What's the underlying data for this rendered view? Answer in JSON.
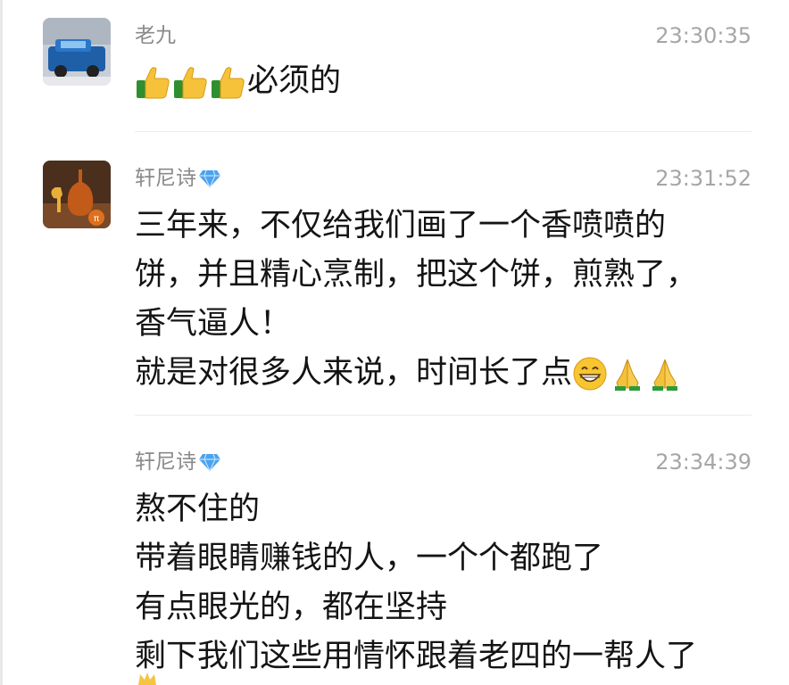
{
  "comments": [
    {
      "user": "老九",
      "time": "23:30:35",
      "lines": [
        "必须的"
      ],
      "emojis": [
        "thumbs-up-icon",
        "thumbs-up-icon",
        "thumbs-up-icon"
      ]
    },
    {
      "user": "轩尼诗",
      "badge": "diamond-icon",
      "time": "23:31:52",
      "lines": [
        "三年来，不仅给我们画了一个香喷喷的",
        "饼，并且精心烹制，把这个饼，煎熟了，",
        "香气逼人！",
        "就是对很多人来说，时间长了点"
      ],
      "trailing_emojis": [
        "grinning-face-icon",
        "praying-hands-icon",
        "praying-hands-icon"
      ]
    },
    {
      "user": "轩尼诗",
      "badge": "diamond-icon",
      "time": "23:34:39",
      "lines": [
        "熬不住的",
        "带着眼睛赚钱的人，一个个都跑了",
        "有点眼光的，都在坚持",
        "剩下我们这些用情怀跟着老四的一帮人了"
      ]
    }
  ],
  "colors": {
    "name": "#8a8a8a",
    "time": "#a6a6a6",
    "text": "#141414",
    "divider": "#ececec",
    "diamond": "#4aa3ee"
  }
}
